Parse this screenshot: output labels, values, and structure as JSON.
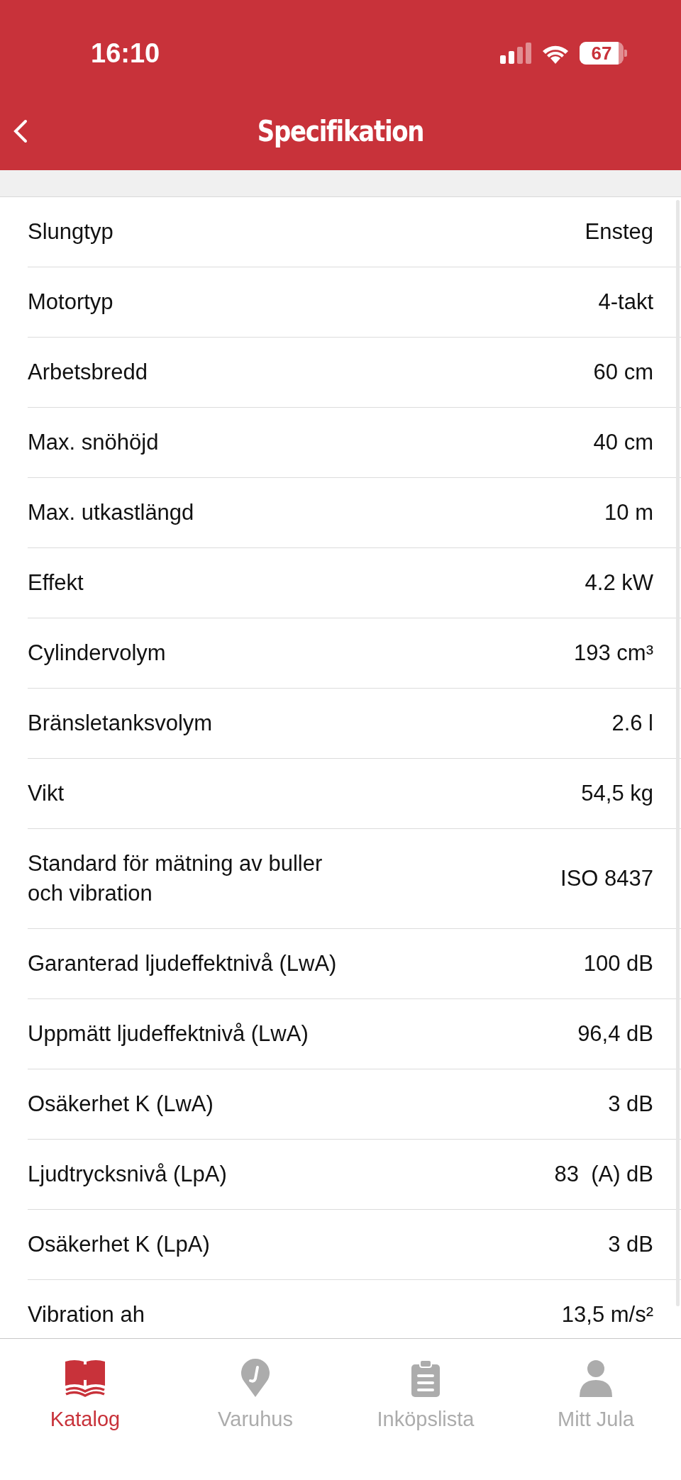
{
  "status_bar": {
    "time": "16:10",
    "battery": "67"
  },
  "header": {
    "title": "Specifikation"
  },
  "specs": [
    {
      "label": "Slungtyp",
      "value": "Ensteg"
    },
    {
      "label": "Motortyp",
      "value": "4-takt"
    },
    {
      "label": "Arbetsbredd",
      "value": "60 cm"
    },
    {
      "label": "Max. snöhöjd",
      "value": "40 cm"
    },
    {
      "label": "Max. utkastlängd",
      "value": "10 m"
    },
    {
      "label": "Effekt",
      "value": "4.2 kW"
    },
    {
      "label": "Cylindervolym",
      "value": "193 cm³"
    },
    {
      "label": "Bränsletanksvolym",
      "value": "2.6 l"
    },
    {
      "label": "Vikt",
      "value": "54,5 kg"
    },
    {
      "label": "Standard för mätning av buller och vibration",
      "value": "ISO 8437"
    },
    {
      "label": "Garanterad ljudeffektnivå (LwA)",
      "value": "100 dB"
    },
    {
      "label": "Uppmätt ljudeffektnivå (LwA)",
      "value": "96,4 dB"
    },
    {
      "label": "Osäkerhet K (LwA)",
      "value": "3 dB"
    },
    {
      "label": "Ljudtrycksnivå (LpA)",
      "value": "83  (A) dB"
    },
    {
      "label": "Osäkerhet K (LpA)",
      "value": "3 dB"
    },
    {
      "label": "Vibration ah",
      "value": "13,5 m/s²"
    }
  ],
  "tab_bar": [
    {
      "kind": "book",
      "label": "Katalog",
      "selected": true
    },
    {
      "kind": "pin",
      "label": "Varuhus",
      "selected": false
    },
    {
      "kind": "clipboard",
      "label": "Inköpslista",
      "selected": false
    },
    {
      "kind": "person",
      "label": "Mitt Jula",
      "selected": false
    }
  ]
}
